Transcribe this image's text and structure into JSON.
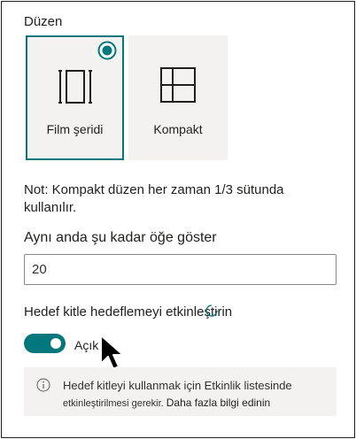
{
  "layout": {
    "label": "Düzen",
    "options": [
      {
        "label": "Film şeridi",
        "icon": "filmstrip-icon",
        "selected": true
      },
      {
        "label": "Kompakt",
        "icon": "compact-grid-icon",
        "selected": false
      }
    ]
  },
  "note": "Not: Kompakt düzen her zaman 1/3 sütunda kullanılır.",
  "item_count": {
    "label": "Aynı anda şu kadar öğe göster",
    "value": "20"
  },
  "audience_targeting": {
    "label": "Hedef kitle hedeflemeyi etkinleştirin",
    "state_label": "Açık",
    "enabled": true
  },
  "info": {
    "line1": "Hedef kitleyi kullanmak için Etkinlik listesinde",
    "line2": "etkinleştirilmesi gerekir.",
    "link": "Daha fazla bilgi edinin"
  },
  "colors": {
    "accent": "#03787c",
    "card_bg": "#f3f2f1",
    "text": "#201f1e"
  }
}
